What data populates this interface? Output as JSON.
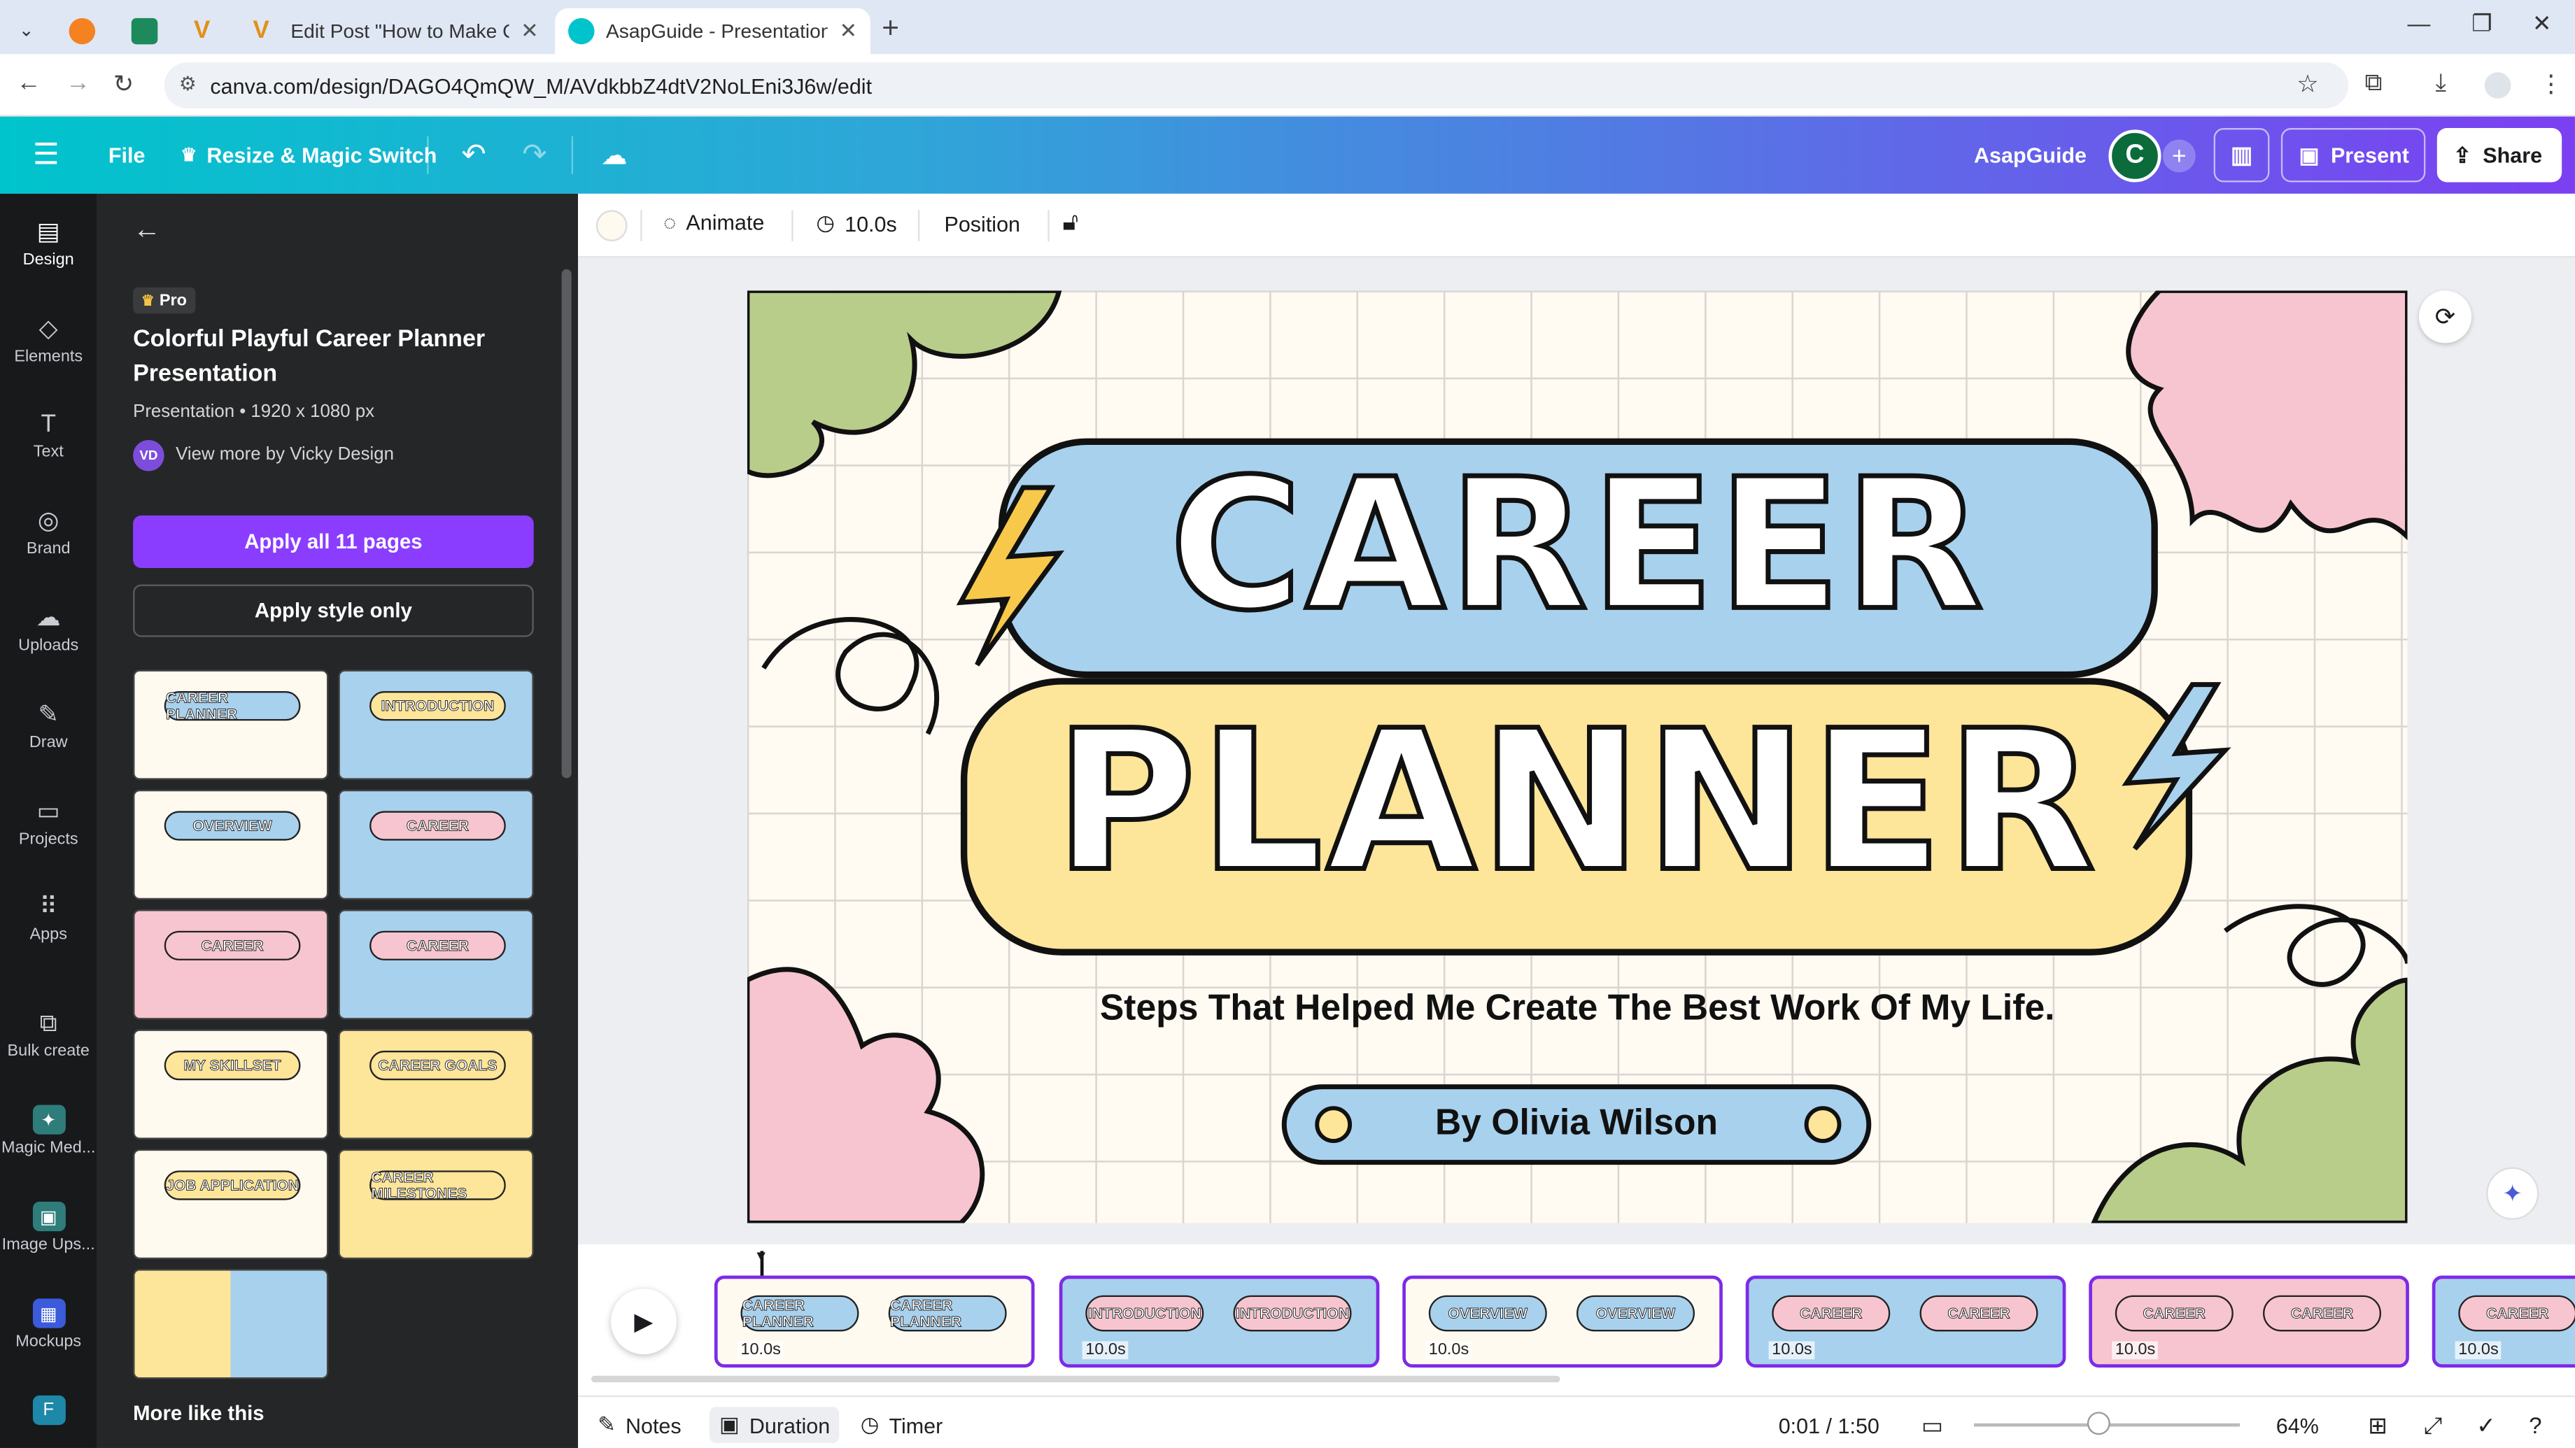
{
  "browser": {
    "tabs": [
      {
        "label": "",
        "icon": "pinned-tab-icon"
      },
      {
        "label": "",
        "icon": "pinned-tab-icon"
      },
      {
        "label": "",
        "icon": "v-logo-icon"
      },
      {
        "label": "Edit Post \"How to Make Canva",
        "icon": "v-logo-icon"
      },
      {
        "label": "AsapGuide - Presentation",
        "icon": "canva-icon"
      }
    ],
    "url": "canva.com/design/DAGO4QmQW_M/AVdkbbZ4dtV2NoLEni3J6w/edit"
  },
  "header": {
    "file_label": "File",
    "resize_label": "Resize & Magic Switch",
    "team_name": "AsapGuide",
    "avatar_letter": "C",
    "present_label": "Present",
    "share_label": "Share"
  },
  "rail": [
    {
      "label": "Design",
      "icon": "design-icon"
    },
    {
      "label": "Elements",
      "icon": "elements-icon"
    },
    {
      "label": "Text",
      "icon": "text-icon"
    },
    {
      "label": "Brand",
      "icon": "brand-icon"
    },
    {
      "label": "Uploads",
      "icon": "uploads-icon"
    },
    {
      "label": "Draw",
      "icon": "draw-icon"
    },
    {
      "label": "Projects",
      "icon": "projects-icon"
    },
    {
      "label": "Apps",
      "icon": "apps-icon"
    },
    {
      "label": "Bulk create",
      "icon": "bulk-create-icon"
    },
    {
      "label": "Magic Med...",
      "icon": "magic-media-icon"
    },
    {
      "label": "Image Ups...",
      "icon": "image-upscaler-icon"
    },
    {
      "label": "Mockups",
      "icon": "mockups-icon"
    }
  ],
  "panel": {
    "pro_badge": "Pro",
    "title": "Colorful Playful Career Planner Presentation",
    "meta": "Presentation • 1920 x 1080 px",
    "author_initials": "VD",
    "author_link": "View more by Vicky Design",
    "apply_all": "Apply all 11 pages",
    "apply_style": "Apply style only",
    "more_like_this": "More like this",
    "thumbs": [
      "CAREER PLANNER",
      "INTRODUCTION",
      "OVERVIEW",
      "CAREER",
      "CAREER",
      "CAREER",
      "MY SKILLSET",
      "CAREER GOALS",
      "JOB APPLICATION",
      "CAREER MILESTONES",
      ""
    ]
  },
  "toolbar": {
    "animate_label": "Animate",
    "duration_label": "10.0s",
    "position_label": "Position"
  },
  "slide": {
    "line1": "CAREER",
    "line2": "PLANNER",
    "subtitle": "Steps That Helped Me Create The Best Work Of My Life.",
    "byline": "By Olivia Wilson"
  },
  "timeline": {
    "pages": [
      {
        "duration": "10.0s",
        "label": "CAREER PLANNER"
      },
      {
        "duration": "10.0s",
        "label": "INTRODUCTION"
      },
      {
        "duration": "10.0s",
        "label": "OVERVIEW"
      },
      {
        "duration": "10.0s",
        "label": "CAREER"
      },
      {
        "duration": "10.0s",
        "label": "CAREER"
      },
      {
        "duration": "10.0s",
        "label": "CAREER"
      }
    ]
  },
  "footer": {
    "notes_label": "Notes",
    "duration_label": "Duration",
    "timer_label": "Timer",
    "time_readout": "0:01 / 1:50",
    "zoom_label": "64%",
    "zoom_fraction": 0.47
  },
  "colors": {
    "accent_purple": "#8b3dff",
    "blue_pill": "#a8d1ee",
    "yellow_pill": "#fde59a",
    "pink": "#f7c5cf",
    "green": "#b8cd8a"
  }
}
